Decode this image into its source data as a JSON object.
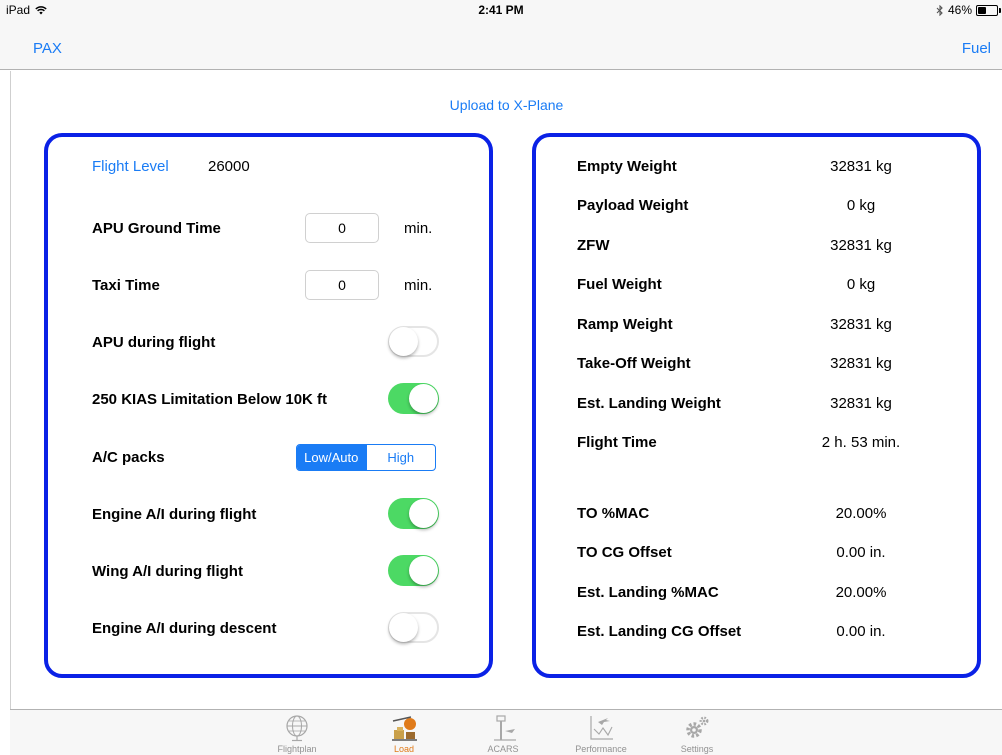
{
  "status_bar": {
    "device": "iPad",
    "time": "2:41 PM",
    "battery": "46%",
    "battery_level": 0.46
  },
  "nav": {
    "left": "PAX",
    "right": "Fuel"
  },
  "upload_label": "Upload to X-Plane",
  "left_panel": {
    "flight_level_label": "Flight Level",
    "flight_level_value": "26000",
    "apu_ground_time": {
      "label": "APU Ground Time",
      "value": "0",
      "unit": "min."
    },
    "taxi_time": {
      "label": "Taxi Time",
      "value": "0",
      "unit": "min."
    },
    "apu_during_flight": {
      "label": "APU during flight",
      "on": false
    },
    "kias_limit": {
      "label": "250 KIAS Limitation Below 10K ft",
      "on": true
    },
    "ac_packs": {
      "label": "A/C packs",
      "options": [
        "Low/Auto",
        "High"
      ],
      "selected": "Low/Auto"
    },
    "engine_ai_flight": {
      "label": "Engine A/I during flight",
      "on": true
    },
    "wing_ai_flight": {
      "label": "Wing A/I during flight",
      "on": true
    },
    "engine_ai_descent": {
      "label": "Engine A/I during descent",
      "on": false
    }
  },
  "right_panel": {
    "weights": [
      {
        "label": "Empty Weight",
        "value": "32831 kg"
      },
      {
        "label": "Payload Weight",
        "value": "0 kg"
      },
      {
        "label": "ZFW",
        "value": "32831 kg"
      },
      {
        "label": "Fuel Weight",
        "value": "0 kg"
      },
      {
        "label": "Ramp Weight",
        "value": "32831 kg"
      },
      {
        "label": "Take-Off Weight",
        "value": "32831 kg"
      },
      {
        "label": "Est. Landing Weight",
        "value": "32831 kg"
      },
      {
        "label": "Flight Time",
        "value": "2 h. 53 min."
      }
    ],
    "balance": [
      {
        "label": "TO %MAC",
        "value": "20.00%"
      },
      {
        "label": "TO CG Offset",
        "value": "0.00 in."
      },
      {
        "label": "Est. Landing %MAC",
        "value": "20.00%"
      },
      {
        "label": "Est. Landing CG Offset",
        "value": "0.00 in."
      }
    ]
  },
  "tabs": [
    {
      "label": "Flightplan",
      "icon": "globe-icon",
      "active": false
    },
    {
      "label": "Load",
      "icon": "load-icon",
      "active": true
    },
    {
      "label": "ACARS",
      "icon": "tower-icon",
      "active": false
    },
    {
      "label": "Performance",
      "icon": "performance-chart-icon",
      "active": false
    },
    {
      "label": "Settings",
      "icon": "gear-icon",
      "active": false
    }
  ],
  "colors": {
    "accent": "#1a7cf5",
    "panel_border": "#0a21e6",
    "toggle_on": "#4cd964",
    "active_tab": "#e07b1a"
  }
}
